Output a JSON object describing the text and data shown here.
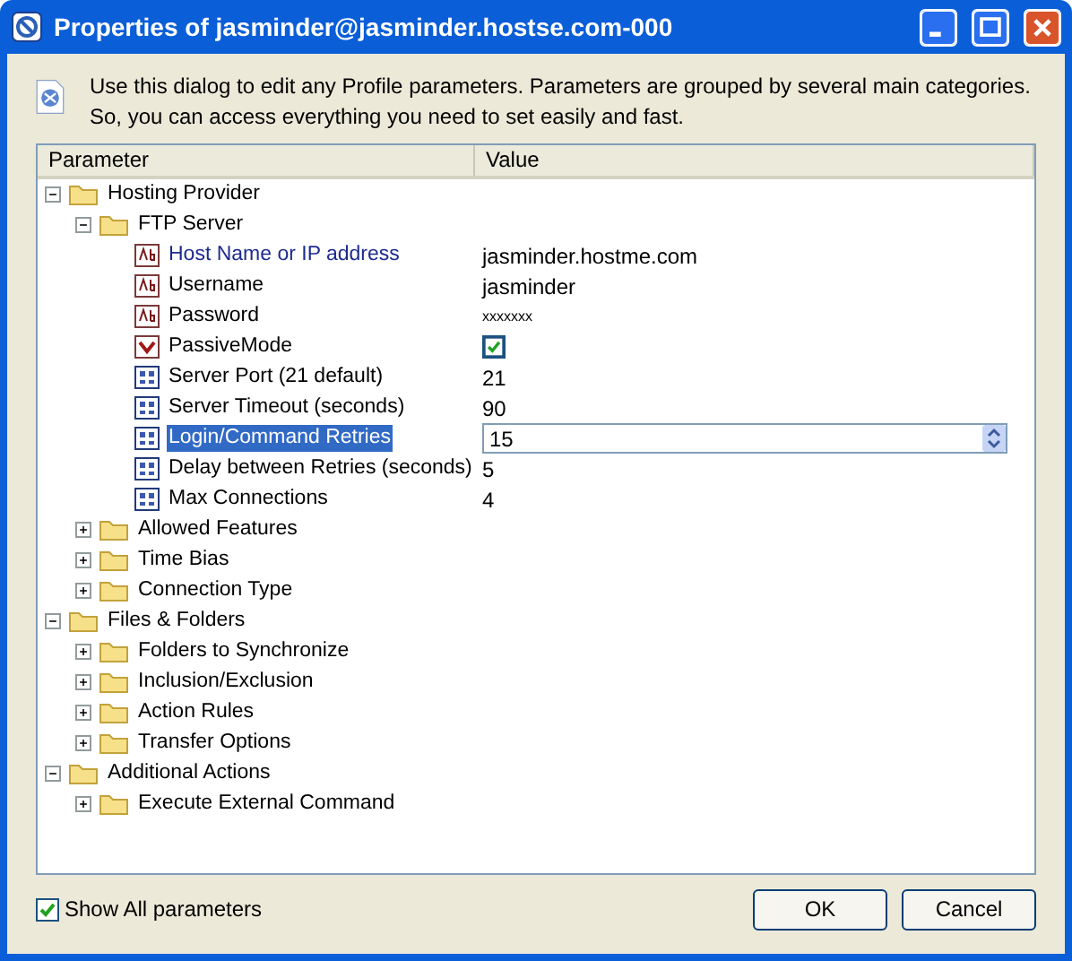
{
  "window": {
    "title": "Properties of jasminder@jasminder.hostse.com-000"
  },
  "intro": "Use this dialog to edit any Profile parameters. Parameters are grouped by several main categories. So, you can access everything you need to set easily and fast.",
  "table": {
    "columns": [
      "Parameter",
      "Value"
    ],
    "tree": [
      {
        "label": "Hosting Provider",
        "expanded": true,
        "children": [
          {
            "label": "FTP Server",
            "expanded": true,
            "children": [
              {
                "kind": "text",
                "label": "Host Name or IP address",
                "value": "jasminder.hostme.com",
                "modified": true,
                "selected": false
              },
              {
                "kind": "text",
                "label": "Username",
                "value": "jasminder",
                "modified": false,
                "selected": false
              },
              {
                "kind": "password",
                "label": "Password",
                "value": "xxxxxxx",
                "modified": false,
                "selected": false
              },
              {
                "kind": "bool",
                "label": "PassiveMode",
                "checked": true,
                "modified": false,
                "selected": false
              },
              {
                "kind": "number",
                "label": "Server Port (21 default)",
                "value": "21",
                "modified": false,
                "selected": false
              },
              {
                "kind": "number",
                "label": "Server Timeout (seconds)",
                "value": "90",
                "modified": false,
                "selected": false
              },
              {
                "kind": "number",
                "label": "Login/Command Retries",
                "value": "15",
                "modified": false,
                "selected": true
              },
              {
                "kind": "number",
                "label": "Delay between Retries (seconds)",
                "value": "5",
                "modified": false,
                "selected": false
              },
              {
                "kind": "number",
                "label": "Max Connections",
                "value": "4",
                "modified": false,
                "selected": false
              }
            ]
          },
          {
            "label": "Allowed Features",
            "expanded": false
          },
          {
            "label": "Time Bias",
            "expanded": false
          },
          {
            "label": "Connection Type",
            "expanded": false
          }
        ]
      },
      {
        "label": "Files & Folders",
        "expanded": true,
        "children": [
          {
            "label": "Folders to Synchronize",
            "expanded": false
          },
          {
            "label": "Inclusion/Exclusion",
            "expanded": false
          },
          {
            "label": "Action Rules",
            "expanded": false
          },
          {
            "label": "Transfer Options",
            "expanded": false
          }
        ]
      },
      {
        "label": "Additional Actions",
        "expanded": true,
        "children": [
          {
            "label": "Execute External Command",
            "expanded": false
          }
        ]
      }
    ]
  },
  "show_all": {
    "label": "Show All parameters",
    "checked": true
  },
  "buttons": [
    "OK",
    "Cancel"
  ]
}
